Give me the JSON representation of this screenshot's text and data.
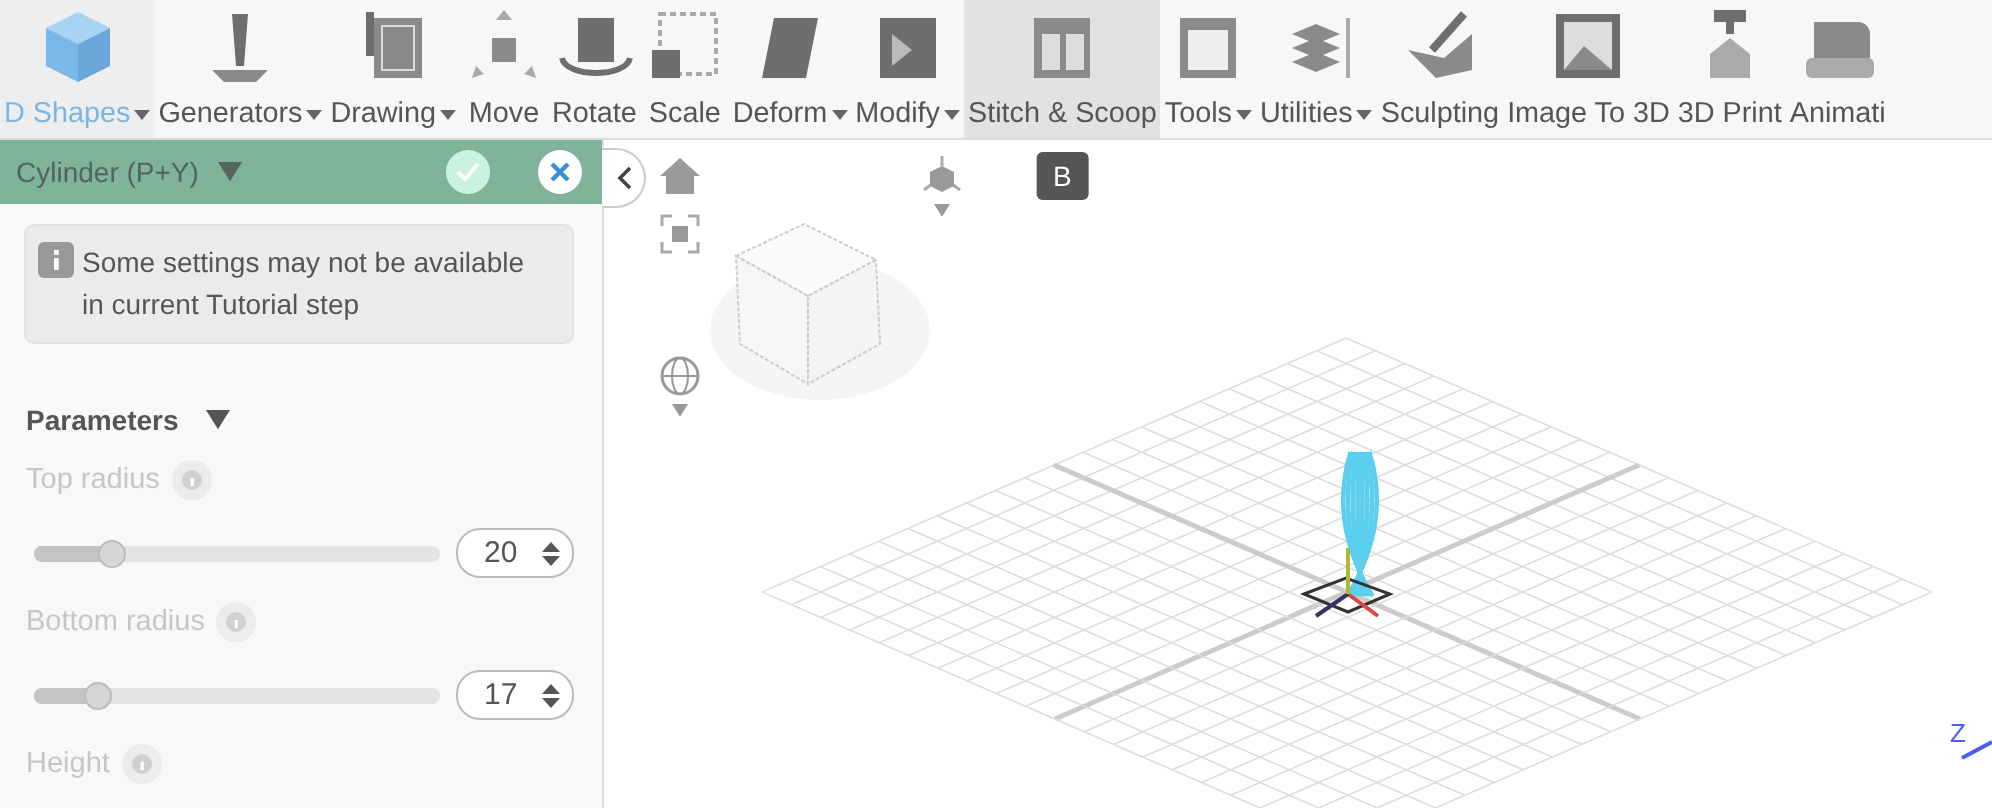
{
  "toolbar": {
    "items": [
      {
        "label": "D Shapes",
        "dropdown": true,
        "selected": true,
        "hovered": false
      },
      {
        "label": "Generators",
        "dropdown": true,
        "selected": false,
        "hovered": false
      },
      {
        "label": "Drawing",
        "dropdown": true,
        "selected": false,
        "hovered": false
      },
      {
        "label": "Move",
        "dropdown": false,
        "selected": false,
        "hovered": false
      },
      {
        "label": "Rotate",
        "dropdown": false,
        "selected": false,
        "hovered": false
      },
      {
        "label": "Scale",
        "dropdown": false,
        "selected": false,
        "hovered": false
      },
      {
        "label": "Deform",
        "dropdown": true,
        "selected": false,
        "hovered": false
      },
      {
        "label": "Modify",
        "dropdown": true,
        "selected": false,
        "hovered": false
      },
      {
        "label": "Stitch & Scoop",
        "dropdown": false,
        "selected": false,
        "hovered": true,
        "tooltip": "B"
      },
      {
        "label": "Tools",
        "dropdown": true,
        "selected": false,
        "hovered": false
      },
      {
        "label": "Utilities",
        "dropdown": true,
        "selected": false,
        "hovered": false
      },
      {
        "label": "Sculpting",
        "dropdown": false,
        "selected": false,
        "hovered": false
      },
      {
        "label": "Image To 3D",
        "dropdown": false,
        "selected": false,
        "hovered": false
      },
      {
        "label": "3D Print",
        "dropdown": false,
        "selected": false,
        "hovered": false
      },
      {
        "label": "Animati",
        "dropdown": false,
        "selected": false,
        "hovered": false
      }
    ]
  },
  "panel": {
    "title": "Cylinder (P+Y)",
    "notice": "Some settings may not be available in current Tutorial step",
    "section": "Parameters",
    "params": [
      {
        "label": "Top radius",
        "disabled": true,
        "level": 0.19,
        "value": "20"
      },
      {
        "label": "Bottom radius",
        "disabled": true,
        "level": 0.16,
        "value": "17"
      },
      {
        "label": "Height",
        "disabled": true
      }
    ]
  },
  "viewport": {
    "axis_label": "Z"
  }
}
